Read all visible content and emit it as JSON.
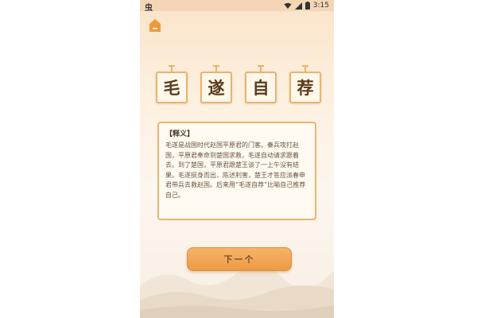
{
  "status_bar": {
    "left_text": "虫",
    "time": "3:15",
    "icons": [
      "wifi-icon",
      "signal-icon",
      "battery-icon"
    ]
  },
  "title_chars": [
    "毛",
    "遂",
    "自",
    "荐"
  ],
  "panel": {
    "heading": "【释义】",
    "body": "毛遂是战国时代赵国平原君的门客。秦兵攻打赵国，平原君奉命到楚国求救，毛遂自动请求跟着去。到了楚国，平原君跟楚王谈了一上午没有结果。毛遂挺身而出，陈述利害，楚王才答应派春申君带兵去救赵国。后来用“毛遂自荐”比喻自己推荐自己。"
  },
  "next_button": {
    "label": "下一个"
  },
  "colors": {
    "accent": "#ec9a45",
    "border": "#e8b570",
    "background": "#fdf0e0"
  }
}
